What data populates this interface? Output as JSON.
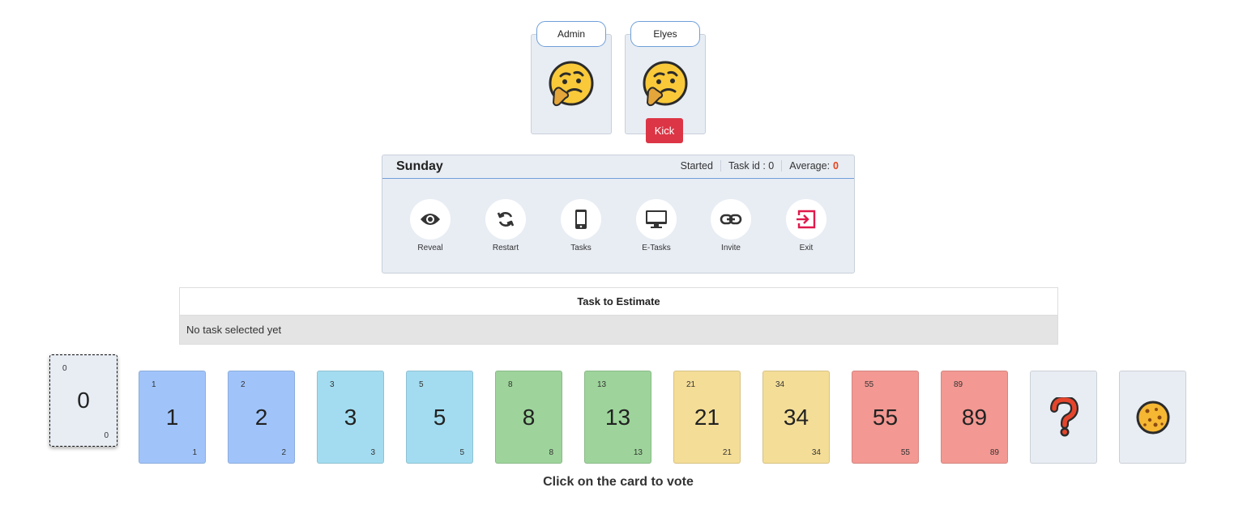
{
  "players": [
    {
      "name": "Admin",
      "status_icon": "thinking-face-icon"
    },
    {
      "name": "Elyes",
      "status_icon": "thinking-face-icon",
      "kick_label": "Kick"
    }
  ],
  "room": {
    "title": "Sunday",
    "status": "Started",
    "task_id_label": "Task id : 0",
    "average_label": "Average:",
    "average_value": "0",
    "actions": [
      {
        "label": "Reveal",
        "icon": "eye-icon"
      },
      {
        "label": "Restart",
        "icon": "refresh-icon"
      },
      {
        "label": "Tasks",
        "icon": "mobile-phone-icon"
      },
      {
        "label": "E-Tasks",
        "icon": "monitor-icon"
      },
      {
        "label": "Invite",
        "icon": "link-icon"
      },
      {
        "label": "Exit",
        "icon": "exit-icon"
      }
    ]
  },
  "task_table": {
    "header": "Task to Estimate",
    "empty_text": "No task selected yet"
  },
  "cards": [
    {
      "value": "0",
      "selected": true,
      "color": "#e8edf4"
    },
    {
      "value": "1",
      "color": "#a0c4fa"
    },
    {
      "value": "2",
      "color": "#a0c4fa"
    },
    {
      "value": "3",
      "color": "#a3dcf0"
    },
    {
      "value": "5",
      "color": "#a3dcf0"
    },
    {
      "value": "8",
      "color": "#9ed49b"
    },
    {
      "value": "13",
      "color": "#9ed49b"
    },
    {
      "value": "21",
      "color": "#f4dd97"
    },
    {
      "value": "34",
      "color": "#f4dd97"
    },
    {
      "value": "55",
      "color": "#f39892"
    },
    {
      "value": "89",
      "color": "#f39892"
    },
    {
      "value": "?",
      "icon": "question-mark-icon",
      "color": "#e8edf4"
    },
    {
      "value": "coffee",
      "icon": "cookie-icon",
      "color": "#e8edf4"
    }
  ],
  "hint": "Click on the card to vote"
}
